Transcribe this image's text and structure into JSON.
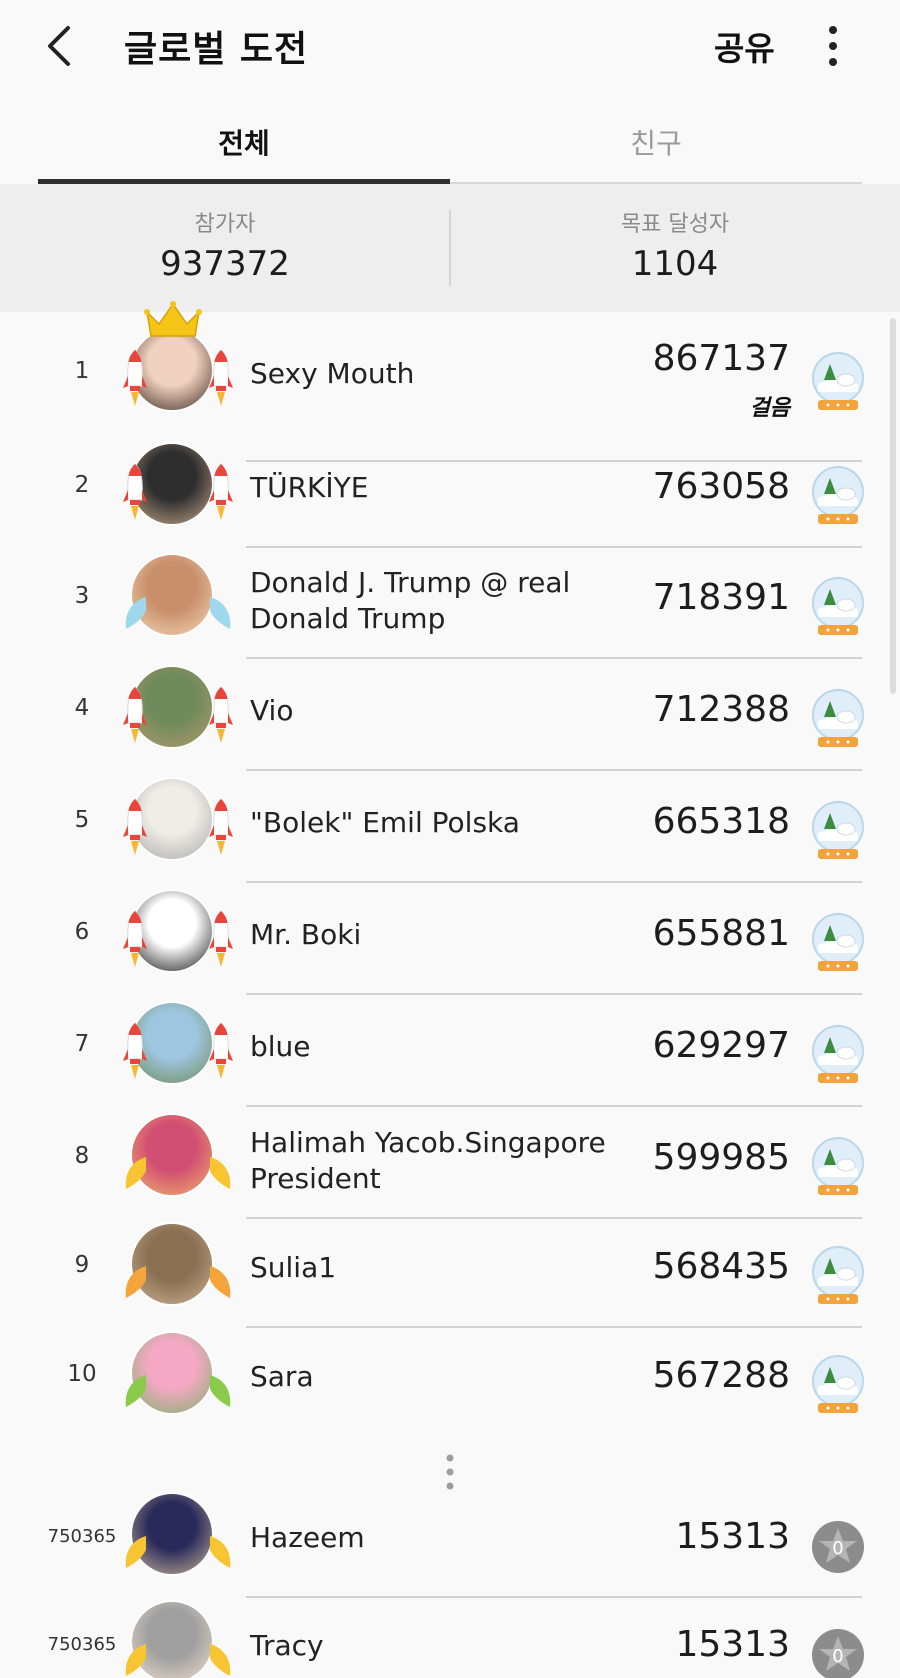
{
  "header": {
    "back_icon": "chevron-left-icon",
    "title": "글로벌 도전",
    "share_label": "공유",
    "more_icon": "more-vertical-icon"
  },
  "tabs": [
    {
      "label": "전체",
      "selected": true
    },
    {
      "label": "친구",
      "selected": false
    }
  ],
  "stats": {
    "participants_label": "참가자",
    "participants_value": "937372",
    "achievers_label": "목표 달성자",
    "achievers_value": "1104"
  },
  "leaderboard": [
    {
      "rank": "1",
      "name": "Sexy Mouth",
      "score": "867137",
      "unit": "걸음",
      "badge": "rocket",
      "crown": true,
      "trophy": "snow-globe"
    },
    {
      "rank": "2",
      "name": "TÜRKİYE",
      "score": "763058",
      "badge": "rocket",
      "trophy": "snow-globe"
    },
    {
      "rank": "3",
      "name": "Donald J. Trump @ real Donald Trump",
      "score": "718391",
      "badge": "wing-blue",
      "trophy": "snow-globe"
    },
    {
      "rank": "4",
      "name": "Vio",
      "score": "712388",
      "badge": "rocket",
      "trophy": "snow-globe"
    },
    {
      "rank": "5",
      "name": "\"Bolek\" Emil Polska",
      "score": "665318",
      "badge": "rocket",
      "trophy": "snow-globe"
    },
    {
      "rank": "6",
      "name": "Mr. Boki",
      "score": "655881",
      "badge": "rocket",
      "trophy": "snow-globe"
    },
    {
      "rank": "7",
      "name": "blue",
      "score": "629297",
      "badge": "rocket",
      "trophy": "snow-globe"
    },
    {
      "rank": "8",
      "name": "Halimah Yacob.Singapore President",
      "score": "599985",
      "badge": "wing-yellow",
      "trophy": "snow-globe"
    },
    {
      "rank": "9",
      "name": "Sulia1",
      "score": "568435",
      "badge": "wing-orange",
      "trophy": "snow-globe"
    },
    {
      "rank": "10",
      "name": "Sara",
      "score": "567288",
      "badge": "wing-green",
      "trophy": "snow-globe"
    }
  ],
  "me_rows": [
    {
      "rank": "750365",
      "name": "Hazeem",
      "score": "15313",
      "badge": "wing-yellow",
      "trophy": "zero-star-medal",
      "medal_text": "0"
    },
    {
      "rank": "750365",
      "name": "Tracy",
      "score": "15313",
      "badge": "wing-yellow",
      "trophy": "zero-star-medal",
      "medal_text": "0"
    }
  ],
  "colors": {
    "rocket_red": "#e8453c",
    "wing_blue": "#9fd7ec",
    "wing_yellow": "#f7c531",
    "wing_orange": "#f4a43a",
    "wing_green": "#8bcb4c",
    "crown_gold": "#f5c518"
  }
}
